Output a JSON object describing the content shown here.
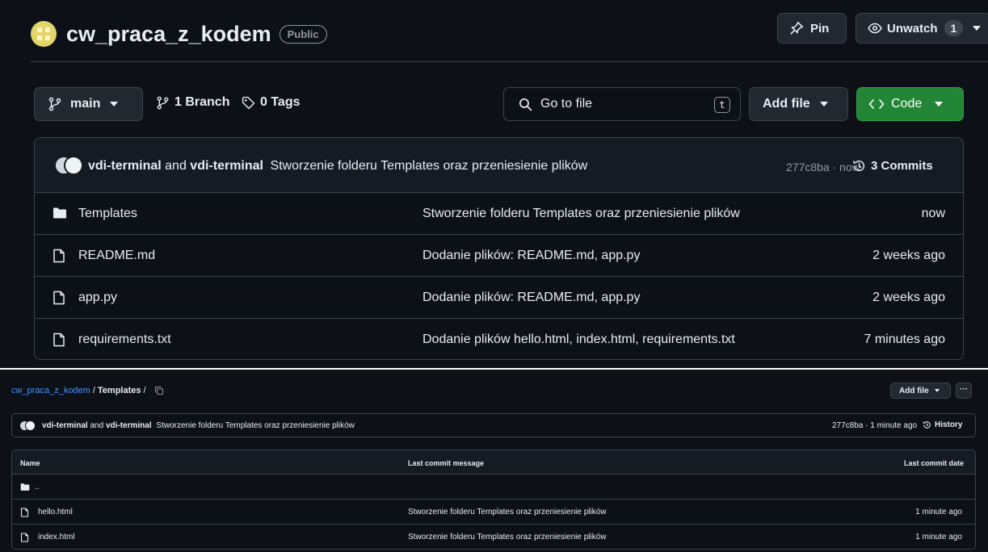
{
  "repo": {
    "name": "cw_praca_z_kodem",
    "visibility": "Public",
    "pin_label": "Pin",
    "unwatch_label": "Unwatch",
    "watchers": "1"
  },
  "toolbar": {
    "branch": "main",
    "branches": "1 Branch",
    "tags": "0 Tags",
    "goto_placeholder": "Go to file",
    "goto_shortcut": "t",
    "add_file": "Add file",
    "code": "Code"
  },
  "latest_commit": {
    "author1": "vdi-terminal",
    "joiner": "and",
    "author2": "vdi-terminal",
    "message": "Stworzenie folderu Templates oraz przeniesienie plików",
    "meta": "277c8ba · now",
    "commits": "3 Commits"
  },
  "files": [
    {
      "name": "Templates",
      "type": "folder",
      "message": "Stworzenie folderu Templates oraz przeniesienie plików",
      "date": "now"
    },
    {
      "name": "README.md",
      "type": "file",
      "message": "Dodanie plików: README.md, app.py",
      "date": "2 weeks ago"
    },
    {
      "name": "app.py",
      "type": "file",
      "message": "Dodanie plików: README.md, app.py",
      "date": "2 weeks ago"
    },
    {
      "name": "requirements.txt",
      "type": "file",
      "message": "Dodanie plików hello.html, index.html, requirements.txt",
      "date": "7 minutes ago"
    }
  ],
  "folder_view": {
    "breadcrumb_repo": "cw_praca_z_kodem",
    "breadcrumb_sep1": "/",
    "breadcrumb_folder": "Templates",
    "breadcrumb_sep2": "/",
    "add_file": "Add file",
    "more": "···",
    "commit": {
      "author1": "vdi-terminal",
      "joiner": "and",
      "author2": "vdi-terminal",
      "message": "Stworzenie folderu Templates oraz przeniesienie plików",
      "meta": "277c8ba · 1 minute ago",
      "history": "History"
    },
    "columns": {
      "name": "Name",
      "message": "Last commit message",
      "date": "Last commit date"
    },
    "parent": "..",
    "rows": [
      {
        "name": "hello.html",
        "message": "Stworzenie folderu Templates oraz przeniesienie plików",
        "date": "1 minute ago"
      },
      {
        "name": "index.html",
        "message": "Stworzenie folderu Templates oraz przeniesienie plików",
        "date": "1 minute ago"
      }
    ]
  },
  "colors": {
    "background": "#0d1117",
    "border": "#3d444d",
    "code_button": "#238636",
    "link": "#4493f8",
    "muted": "#9198a1"
  }
}
